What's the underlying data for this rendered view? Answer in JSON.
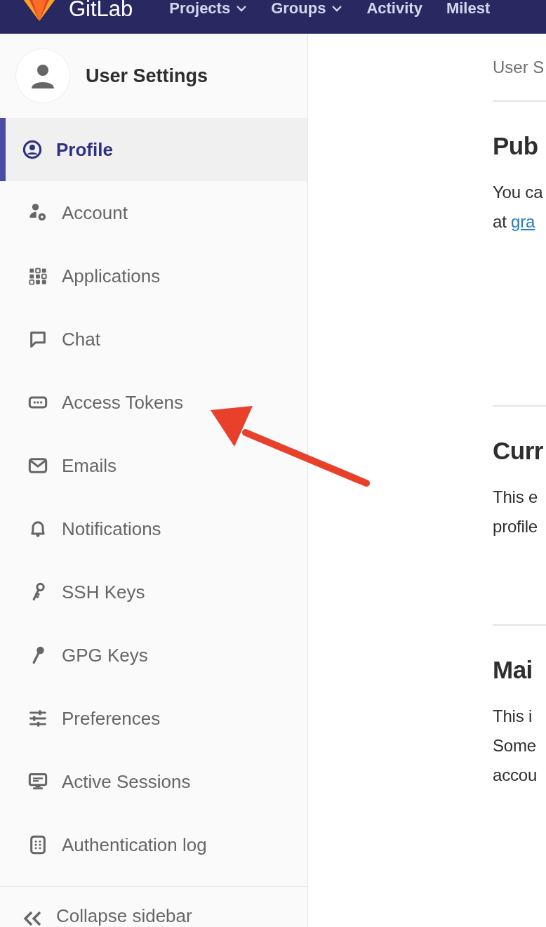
{
  "top_nav": {
    "brand": "GitLab",
    "items": [
      {
        "label": "Projects",
        "dropdown": true
      },
      {
        "label": "Groups",
        "dropdown": true
      },
      {
        "label": "Activity",
        "dropdown": false
      },
      {
        "label": "Milest",
        "dropdown": false
      }
    ]
  },
  "sidebar": {
    "title": "User Settings",
    "items": [
      {
        "label": "Profile",
        "selected": true
      },
      {
        "label": "Account",
        "selected": false
      },
      {
        "label": "Applications",
        "selected": false
      },
      {
        "label": "Chat",
        "selected": false
      },
      {
        "label": "Access Tokens",
        "selected": false
      },
      {
        "label": "Emails",
        "selected": false
      },
      {
        "label": "Notifications",
        "selected": false
      },
      {
        "label": "SSH Keys",
        "selected": false
      },
      {
        "label": "GPG Keys",
        "selected": false
      },
      {
        "label": "Preferences",
        "selected": false
      },
      {
        "label": "Active Sessions",
        "selected": false
      },
      {
        "label": "Authentication log",
        "selected": false
      }
    ],
    "collapse": "Collapse sidebar"
  },
  "main": {
    "breadcrumb": "User S",
    "sections": [
      {
        "heading": "Pub",
        "lines": [
          {
            "text": "You ca"
          },
          {
            "text": "at ",
            "link": "gra"
          }
        ]
      },
      {
        "heading": "Curr",
        "lines": [
          {
            "text": "This e"
          },
          {
            "text": "profile"
          }
        ]
      },
      {
        "heading": "Mai",
        "lines": [
          {
            "text": "This i"
          },
          {
            "text": "Some"
          },
          {
            "text": "accou"
          }
        ]
      }
    ]
  }
}
